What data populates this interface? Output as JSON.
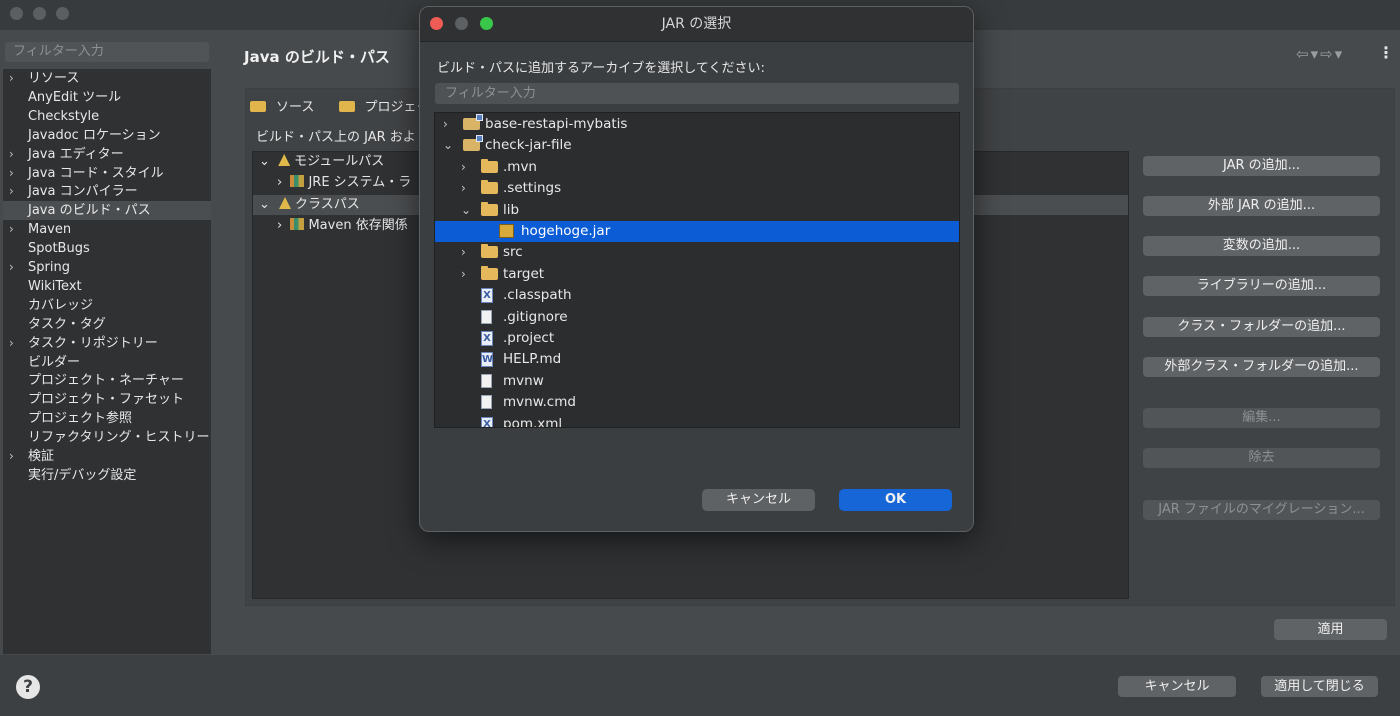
{
  "sidebar": {
    "filter_placeholder": "フィルター入力",
    "items": [
      {
        "label": "リソース",
        "expandable": true
      },
      {
        "label": "AnyEdit ツール",
        "expandable": false
      },
      {
        "label": "Checkstyle",
        "expandable": false
      },
      {
        "label": "Javadoc ロケーション",
        "expandable": false
      },
      {
        "label": "Java エディター",
        "expandable": true
      },
      {
        "label": "Java コード・スタイル",
        "expandable": true
      },
      {
        "label": "Java コンパイラー",
        "expandable": true
      },
      {
        "label": "Java のビルド・パス",
        "expandable": false,
        "selected": true
      },
      {
        "label": "Maven",
        "expandable": true
      },
      {
        "label": "SpotBugs",
        "expandable": false
      },
      {
        "label": "Spring",
        "expandable": true
      },
      {
        "label": "WikiText",
        "expandable": false
      },
      {
        "label": "カバレッジ",
        "expandable": false
      },
      {
        "label": "タスク・タグ",
        "expandable": false
      },
      {
        "label": "タスク・リポジトリー",
        "expandable": true
      },
      {
        "label": "ビルダー",
        "expandable": false
      },
      {
        "label": "プロジェクト・ネーチャー",
        "expandable": false
      },
      {
        "label": "プロジェクト・ファセット",
        "expandable": false
      },
      {
        "label": "プロジェクト参照",
        "expandable": false
      },
      {
        "label": "リファクタリング・ヒストリー",
        "expandable": false
      },
      {
        "label": "検証",
        "expandable": true
      },
      {
        "label": "実行/デバッグ設定",
        "expandable": false
      }
    ]
  },
  "main": {
    "title": "Java のビルド・パス",
    "tabs": [
      "ソース",
      "プロジェク"
    ],
    "description": "ビルド・パス上の JAR およ",
    "tree": [
      {
        "label": "モジュールパス"
      },
      {
        "label": "JRE システム・ラ"
      },
      {
        "label": "クラスパス"
      },
      {
        "label": "Maven 依存関係"
      }
    ],
    "buttons": {
      "add_jar": "JAR の追加...",
      "add_external_jar": "外部 JAR の追加...",
      "add_variable": "変数の追加...",
      "add_library": "ライブラリーの追加...",
      "add_class_folder": "クラス・フォルダーの追加...",
      "add_external_class_folder": "外部クラス・フォルダーの追加...",
      "edit": "編集...",
      "remove": "除去",
      "migrate_jar": "JAR ファイルのマイグレーション..."
    },
    "apply": "適用"
  },
  "footer": {
    "cancel": "キャンセル",
    "apply_close": "適用して閉じる"
  },
  "dialog": {
    "title": "JAR の選択",
    "prompt": "ビルド・パスに追加するアーカイブを選択してください:",
    "filter_placeholder": "フィルター入力",
    "rows": [
      {
        "label": "base-restapi-mybatis",
        "icon": "project-folder-icon",
        "depth": 0,
        "arrow": "›"
      },
      {
        "label": "check-jar-file",
        "icon": "project-folder-icon",
        "depth": 0,
        "arrow": "⌄"
      },
      {
        "label": ".mvn",
        "icon": "folder-icon",
        "depth": 1,
        "arrow": "›"
      },
      {
        "label": ".settings",
        "icon": "folder-icon",
        "depth": 1,
        "arrow": "›"
      },
      {
        "label": "lib",
        "icon": "folder-icon",
        "depth": 1,
        "arrow": "⌄"
      },
      {
        "label": "hogehoge.jar",
        "icon": "jar-file-icon",
        "depth": 2,
        "arrow": "",
        "selected": true
      },
      {
        "label": "src",
        "icon": "folder-icon",
        "depth": 1,
        "arrow": "›"
      },
      {
        "label": "target",
        "icon": "folder-icon",
        "depth": 1,
        "arrow": "›"
      },
      {
        "label": ".classpath",
        "icon": "xml-file-icon",
        "depth": 1,
        "arrow": ""
      },
      {
        "label": ".gitignore",
        "icon": "text-file-icon",
        "depth": 1,
        "arrow": ""
      },
      {
        "label": ".project",
        "icon": "xml-file-icon",
        "depth": 1,
        "arrow": ""
      },
      {
        "label": "HELP.md",
        "icon": "word-file-icon",
        "depth": 1,
        "arrow": ""
      },
      {
        "label": "mvnw",
        "icon": "text-file-icon",
        "depth": 1,
        "arrow": ""
      },
      {
        "label": "mvnw.cmd",
        "icon": "text-file-icon",
        "depth": 1,
        "arrow": ""
      },
      {
        "label": "pom.xml",
        "icon": "xml-file-icon",
        "depth": 1,
        "arrow": ""
      }
    ],
    "cancel": "キャンセル",
    "ok": "OK"
  },
  "colors": {
    "selection": "#0c5cd6",
    "ok_button": "#1666d8",
    "close_dot": "#ee5c55",
    "minimize_dot": "#5d6062",
    "zoom_dot": "#38c74a"
  }
}
